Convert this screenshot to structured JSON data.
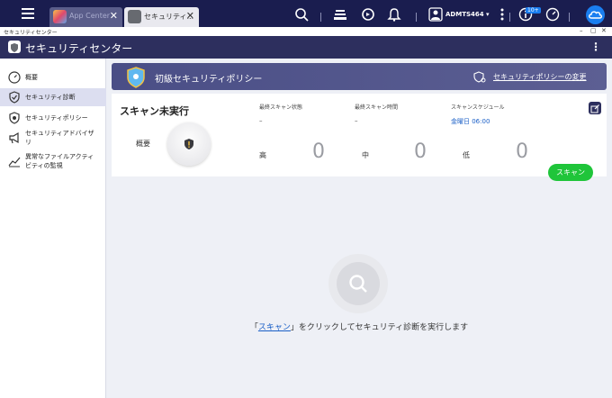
{
  "taskbar": {
    "tabs": [
      {
        "label": "App Center",
        "close": "✕"
      },
      {
        "label": "セキュリティ...",
        "close": "✕"
      }
    ],
    "user": "ADMTS464 ▾",
    "badge": "10+"
  },
  "window": {
    "title": "セキュリティセンター",
    "controls": [
      "–",
      "▢",
      "✕"
    ]
  },
  "app": {
    "title": "セキュリティセンター",
    "more": "⋮"
  },
  "sidebar": {
    "items": [
      {
        "label": "概要",
        "icon": "gauge-icon",
        "active": false
      },
      {
        "label": "セキュリティ診断",
        "icon": "shield-check-icon",
        "active": true
      },
      {
        "label": "セキュリティポリシー",
        "icon": "shield-policy-icon",
        "active": false
      },
      {
        "label": "セキュリティアドバイザリ",
        "icon": "megaphone-icon",
        "active": false
      },
      {
        "label": "異常なファイルアクティビティの監視",
        "icon": "chart-line-icon",
        "active": false
      }
    ]
  },
  "banner": {
    "title": "初級セキュリティポリシー",
    "link": "セキュリティポリシーの変更"
  },
  "summary": {
    "status": "スキャン未実行",
    "overview_label": "概要",
    "columns": [
      {
        "label": "最終スキャン状態",
        "value": "–"
      },
      {
        "label": "最終スキャン時間",
        "value": "–"
      },
      {
        "label": "スキャンスケジュール",
        "value": "金曜日 06:00"
      }
    ],
    "severity": [
      {
        "label": "高",
        "count": "0"
      },
      {
        "label": "中",
        "count": "0"
      },
      {
        "label": "低",
        "count": "0"
      }
    ],
    "scan_button": "スキャン"
  },
  "empty_state": {
    "prefix": "「",
    "link": "スキャン",
    "suffix": "」をクリックしてセキュリティ診断を実行します"
  },
  "colors": {
    "taskbar": "#1a1d4f",
    "app_header": "#2d2f5e",
    "accent": "#1a7ef0",
    "scan_button": "#1fc53a",
    "link": "#1a5fc7"
  }
}
